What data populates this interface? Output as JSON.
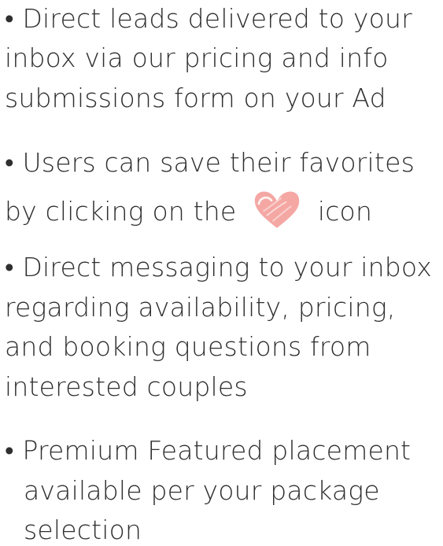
{
  "features": [
    {
      "lines": [
        "• Direct leads delivered to your",
        "inbox via our pricing and info",
        "submissions form on your Ad"
      ]
    },
    {
      "lines": [
        "• Users can save their favorites",
        "by clicking on the",
        "icon"
      ],
      "icon": "heart-icon"
    },
    {
      "lines": [
        "• Direct messaging to your inbox",
        "regarding availability, pricing,",
        "and booking questions from",
        "interested couples"
      ]
    },
    {
      "lines": [
        "• Premium Featured placement",
        "available per your package",
        "selection"
      ]
    }
  ],
  "colors": {
    "text": "#2f2f2f",
    "heart": "#f4a7a3"
  }
}
